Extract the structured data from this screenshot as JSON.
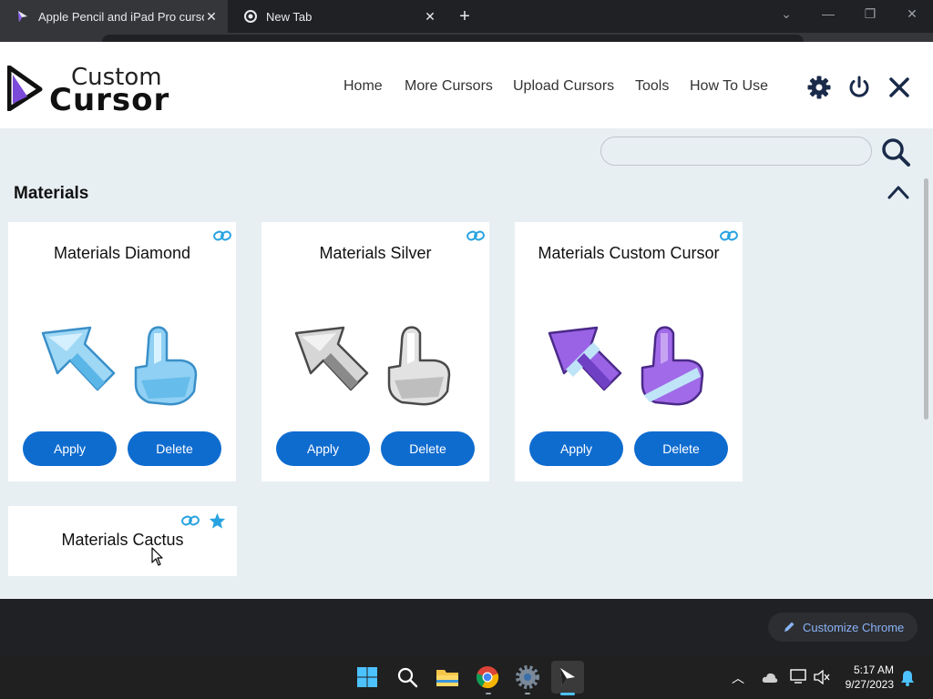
{
  "browser": {
    "tabs": [
      {
        "title": "Apple Pencil and iPad Pro cursor",
        "active": true
      },
      {
        "title": "New Tab",
        "active": false
      }
    ]
  },
  "header": {
    "logo_top": "Custom",
    "logo_bottom": "Cursor",
    "nav": [
      "Home",
      "More Cursors",
      "Upload Cursors",
      "Tools",
      "How To Use"
    ]
  },
  "search": {
    "placeholder": "",
    "value": ""
  },
  "section": {
    "title": "Materials"
  },
  "cards": [
    {
      "title": "Materials Diamond",
      "apply": "Apply",
      "delete": "Delete",
      "theme": "diamond"
    },
    {
      "title": "Materials Silver",
      "apply": "Apply",
      "delete": "Delete",
      "theme": "silver"
    },
    {
      "title": "Materials Custom Cursor",
      "apply": "Apply",
      "delete": "Delete",
      "theme": "purple"
    },
    {
      "title": "Materials Cactus",
      "starred": true
    }
  ],
  "chrome": {
    "customize_label": "Customize Chrome"
  },
  "taskbar": {
    "time": "5:17 AM",
    "date": "9/27/2023"
  },
  "colors": {
    "accent_button": "#0f6ccf",
    "header_icon": "#1a2b4a",
    "link_icon": "#29a3e0",
    "popup_bg": "#e8eff3"
  }
}
